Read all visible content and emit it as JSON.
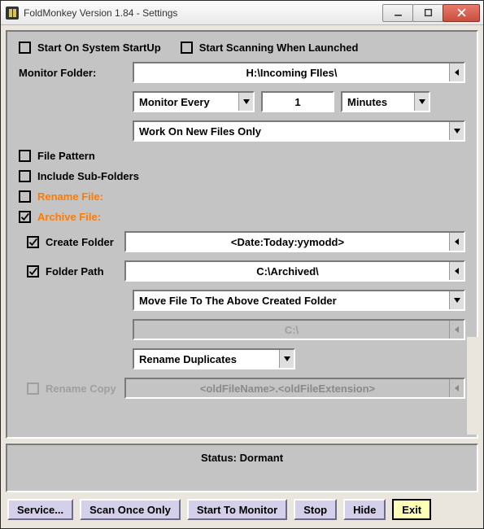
{
  "window": {
    "title": "FoldMonkey Version 1.84 - Settings"
  },
  "startup": {
    "start_on_startup_label": "Start On System StartUp",
    "start_scanning_label": "Start Scanning When Launched"
  },
  "monitor": {
    "label": "Monitor Folder:",
    "path": "H:\\Incoming FIles\\",
    "interval_mode_label": "Monitor Every",
    "interval_value": "1",
    "interval_unit": "Minutes",
    "work_mode": "Work On New Files Only"
  },
  "options": {
    "file_pattern_label": "File Pattern",
    "include_subfolders_label": "Include Sub-Folders",
    "rename_file_label": "Rename File:",
    "archive_file_label": "Archive File:"
  },
  "archive": {
    "create_folder_label": "Create Folder",
    "create_folder_value": "<Date:Today:yymodd>",
    "folder_path_label": "Folder Path",
    "folder_path_value": "C:\\Archived\\",
    "move_action": "Move File To The Above Created Folder",
    "disabled_path": "C:\\",
    "duplicates": "Rename Duplicates",
    "rename_copy_label": "Rename Copy",
    "rename_copy_value": "<oldFileName>.<oldFileExtension>"
  },
  "status": {
    "text": "Status: Dormant"
  },
  "buttons": {
    "service": "Service...",
    "scan_once": "Scan Once Only",
    "start_monitor": "Start To Monitor",
    "stop": "Stop",
    "hide": "Hide",
    "exit": "Exit"
  }
}
